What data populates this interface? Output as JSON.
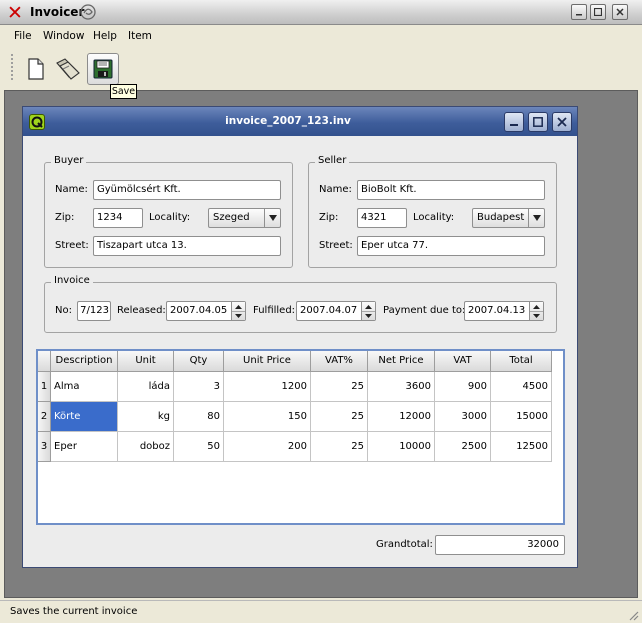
{
  "app": {
    "title": "Invoicer",
    "menu": [
      "File",
      "Window",
      "Help",
      "Item"
    ],
    "tooltip": "Save",
    "status": "Saves the current invoice"
  },
  "document": {
    "title": "invoice_2007_123.inv"
  },
  "buyer": {
    "group_label": "Buyer",
    "name_label": "Name:",
    "name": "Gyümölcsért Kft.",
    "zip_label": "Zip:",
    "zip": "1234",
    "locality_label": "Locality:",
    "locality": "Szeged",
    "street_label": "Street:",
    "street": "Tiszapart utca 13."
  },
  "seller": {
    "group_label": "Seller",
    "name_label": "Name:",
    "name": "BioBolt Kft.",
    "zip_label": "Zip:",
    "zip": "4321",
    "locality_label": "Locality:",
    "locality": "Budapest",
    "street_label": "Street:",
    "street": "Eper utca 77."
  },
  "invoice": {
    "group_label": "Invoice",
    "no_label": "No:",
    "no": "7/123",
    "released_label": "Released:",
    "released": "2007.04.05",
    "fulfilled_label": "Fulfilled:",
    "fulfilled": "2007.04.07",
    "payment_label": "Payment due to:",
    "payment_due": "2007.04.13"
  },
  "items": {
    "columns": [
      "Description",
      "Unit",
      "Qty",
      "Unit Price",
      "VAT%",
      "Net Price",
      "VAT",
      "Total"
    ],
    "rows": [
      {
        "num": "1",
        "cells": [
          "Alma",
          "láda",
          "3",
          "1200",
          "25",
          "3600",
          "900",
          "4500"
        ]
      },
      {
        "num": "2",
        "cells": [
          "Körte",
          "kg",
          "80",
          "150",
          "25",
          "12000",
          "3000",
          "15000"
        ]
      },
      {
        "num": "3",
        "cells": [
          "Eper",
          "doboz",
          "50",
          "200",
          "25",
          "10000",
          "2500",
          "12500"
        ]
      }
    ]
  },
  "grandtotal": {
    "label": "Grandtotal:",
    "value": "32000"
  }
}
